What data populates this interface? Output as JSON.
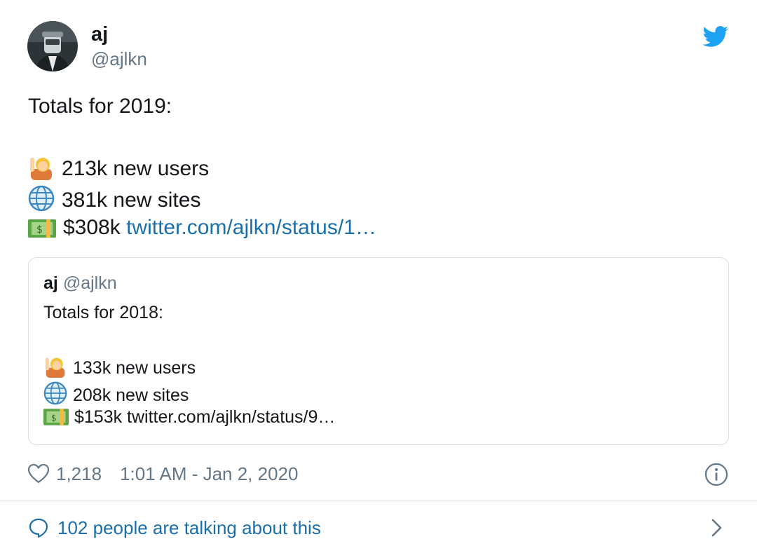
{
  "author": {
    "name": "aj",
    "handle": "@ajlkn"
  },
  "tweet": {
    "intro": "Totals for 2019:",
    "lines": [
      {
        "icon": "raising-hand-icon",
        "text": "213k new users"
      },
      {
        "icon": "globe-icon",
        "text": "381k new sites"
      },
      {
        "icon": "money-icon",
        "text": "$308k",
        "link": "twitter.com/ajlkn/status/1…"
      }
    ]
  },
  "quoted": {
    "name": "aj",
    "handle": "@ajlkn",
    "intro": "Totals for 2018:",
    "lines": [
      {
        "icon": "raising-hand-icon",
        "text": "133k new users"
      },
      {
        "icon": "globe-icon",
        "text": "208k new sites"
      },
      {
        "icon": "money-icon",
        "text": "$153k twitter.com/ajlkn/status/9…"
      }
    ]
  },
  "meta": {
    "likes": "1,218",
    "timestamp": "1:01 AM - Jan 2, 2020"
  },
  "footer": {
    "talking": "102 people are talking about this"
  },
  "colors": {
    "link": "#1b6fa8",
    "twitter_blue": "#1da1f2",
    "muted": "#657786"
  }
}
